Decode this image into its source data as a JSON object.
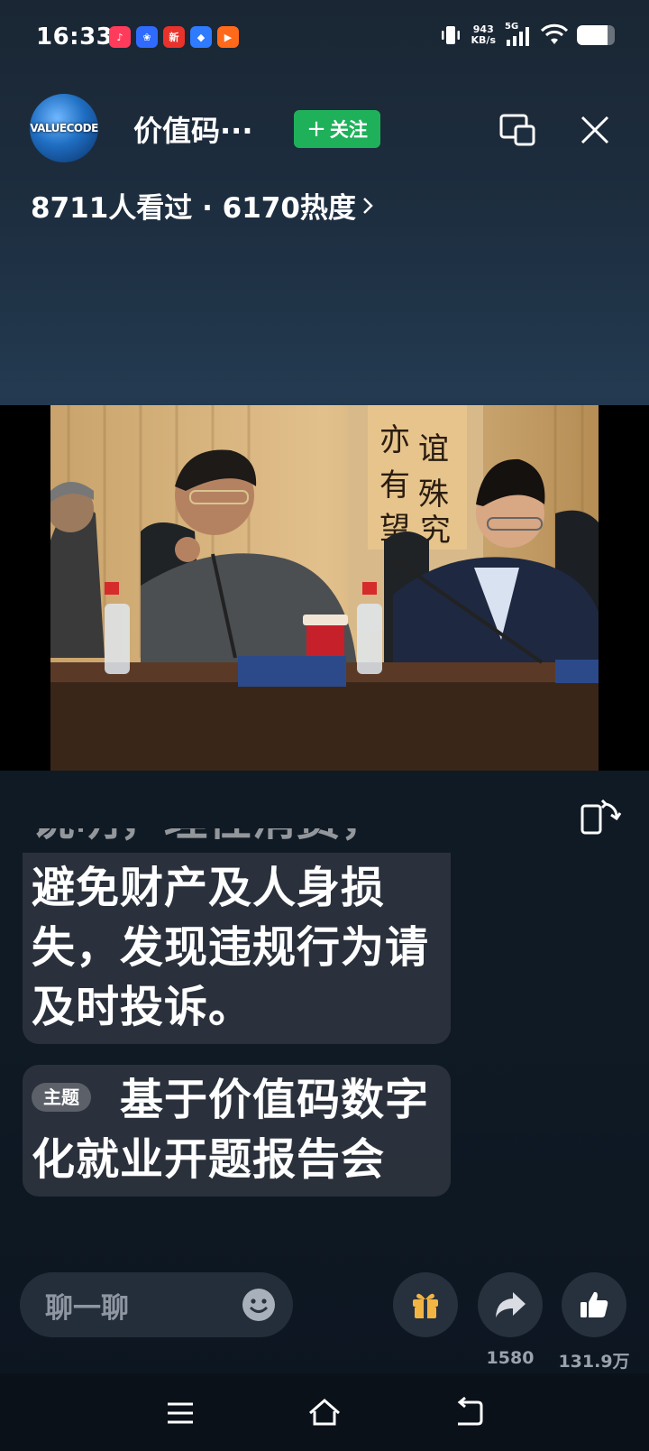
{
  "status_bar": {
    "time": "16:33",
    "app_icons": [
      {
        "name": "douyin-icon",
        "color": "#ff3b5c",
        "glyph": "♪"
      },
      {
        "name": "baidu-icon",
        "color": "#2f6bff",
        "glyph": "❀"
      },
      {
        "name": "news-icon",
        "color": "#e8322b",
        "glyph": "新"
      },
      {
        "name": "browser-icon",
        "color": "#2f7bff",
        "glyph": "◆"
      },
      {
        "name": "video-app-icon",
        "color": "#ff6a1a",
        "glyph": "▶"
      }
    ],
    "net_speed_value": "943",
    "net_speed_unit": "KB/s",
    "signal_label": "5G",
    "battery_level": 0.82
  },
  "header": {
    "avatar_text": "VALUECODE",
    "channel_name": "价值码···",
    "follow_label": "关注",
    "follow_color": "#1fb15a",
    "stats_text": "8711人看过 · 6170热度"
  },
  "captions": {
    "partial_line": "说明，理性消费，",
    "notice_text": "避免财产及人身损失，发现违规行为请及时投诉。",
    "topic_tag": "主题",
    "topic_text": "基于价值码数字化就业开题报告会"
  },
  "bottom_bar": {
    "chat_placeholder": "聊一聊",
    "share_count": "1580",
    "like_count": "131.9万"
  },
  "colors": {
    "accent_green": "#1fb15a",
    "gift_gold": "#f2b544"
  }
}
